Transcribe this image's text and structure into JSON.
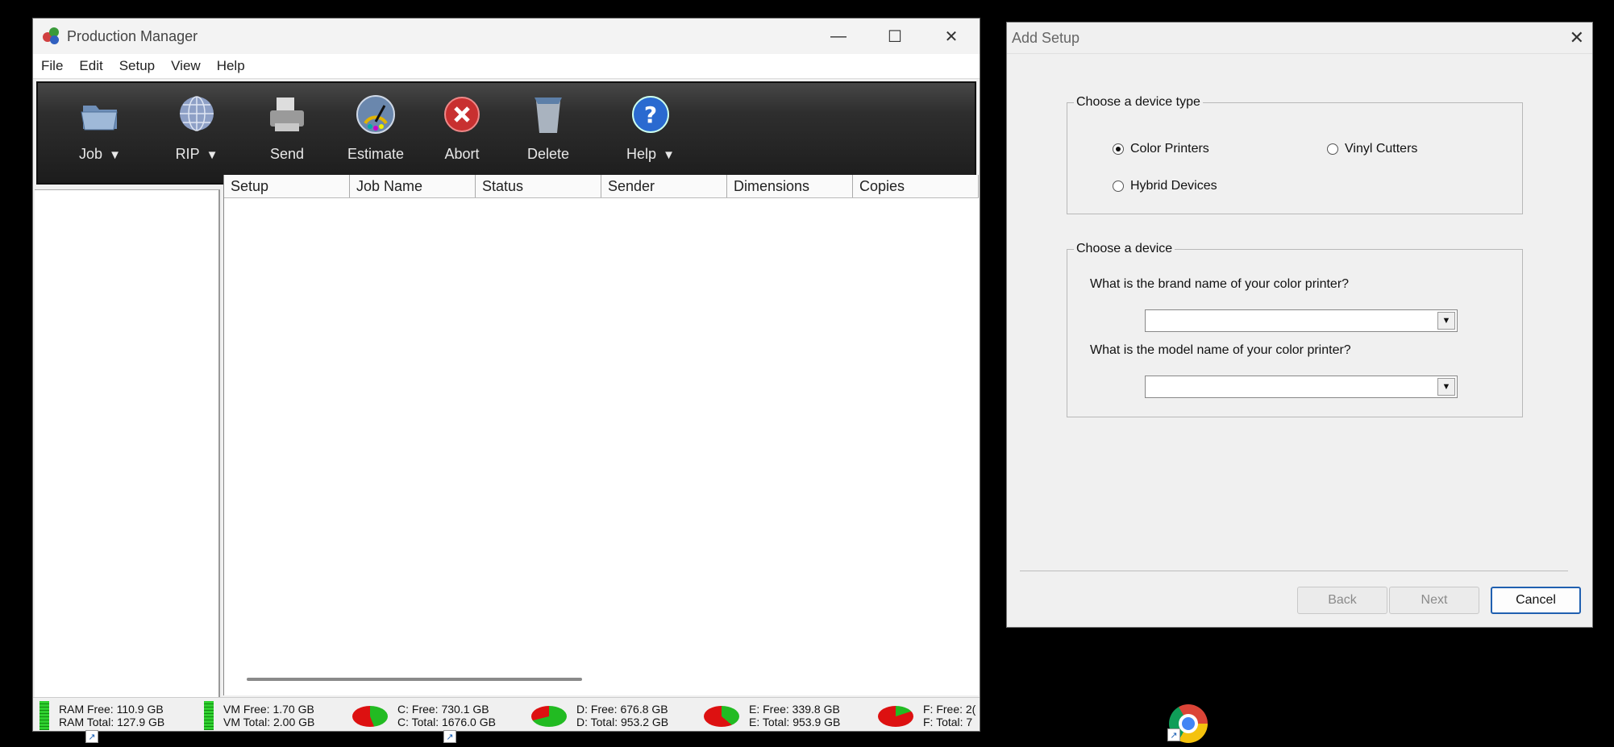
{
  "pm": {
    "title": "Production Manager",
    "window_controls": {
      "minimize": "—",
      "maximize": "☐",
      "close": "✕"
    },
    "menu": [
      "File",
      "Edit",
      "Setup",
      "View",
      "Help"
    ],
    "toolbar": [
      {
        "label": "Job",
        "arrow": "▼",
        "icon": "folder-icon"
      },
      {
        "label": "RIP",
        "arrow": "▼",
        "icon": "globe-icon"
      },
      {
        "label": "Send",
        "arrow": "",
        "icon": "printer-icon"
      },
      {
        "label": "Estimate",
        "arrow": "",
        "icon": "gauge-icon"
      },
      {
        "label": "Abort",
        "arrow": "",
        "icon": "abort-icon"
      },
      {
        "label": "Delete",
        "arrow": "",
        "icon": "trash-icon"
      },
      {
        "label": "Help",
        "arrow": "▼",
        "icon": "help-icon"
      }
    ],
    "columns": [
      "Setup",
      "Job Name",
      "Status",
      "Sender",
      "Dimensions",
      "Copies"
    ],
    "status": {
      "ram": [
        "RAM Free: 110.9 GB",
        "RAM Total: 127.9 GB"
      ],
      "vm": [
        "VM Free: 1.70 GB",
        "VM Total: 2.00 GB"
      ],
      "c": [
        "C: Free: 730.1 GB",
        "C: Total: 1676.0 GB"
      ],
      "d": [
        "D: Free: 676.8 GB",
        "D: Total: 953.2 GB"
      ],
      "e": [
        "E: Free: 339.8 GB",
        "E: Total: 953.9 GB"
      ],
      "f": [
        "F: Free: 2(",
        "F: Total: 7"
      ]
    },
    "pie_free_fractions": {
      "c": 0.44,
      "d": 0.71,
      "e": 0.36,
      "f": 0.2
    },
    "colors": {
      "toolbar": "#2e2e2e",
      "free": "#22bb22",
      "used": "#dd1111"
    }
  },
  "dialog": {
    "title": "Add Setup",
    "close": "✕",
    "device_type": {
      "legend": "Choose a device type",
      "options": [
        "Color Printers",
        "Vinyl Cutters",
        "Hybrid Devices"
      ],
      "selected": "Color Printers"
    },
    "device": {
      "legend": "Choose a device",
      "brand_question": "What is the brand name of your color printer?",
      "brand_value": "",
      "model_question": "What is the model name of your color printer?",
      "model_value": ""
    },
    "buttons": {
      "back": "Back",
      "next": "Next",
      "cancel": "Cancel"
    }
  }
}
